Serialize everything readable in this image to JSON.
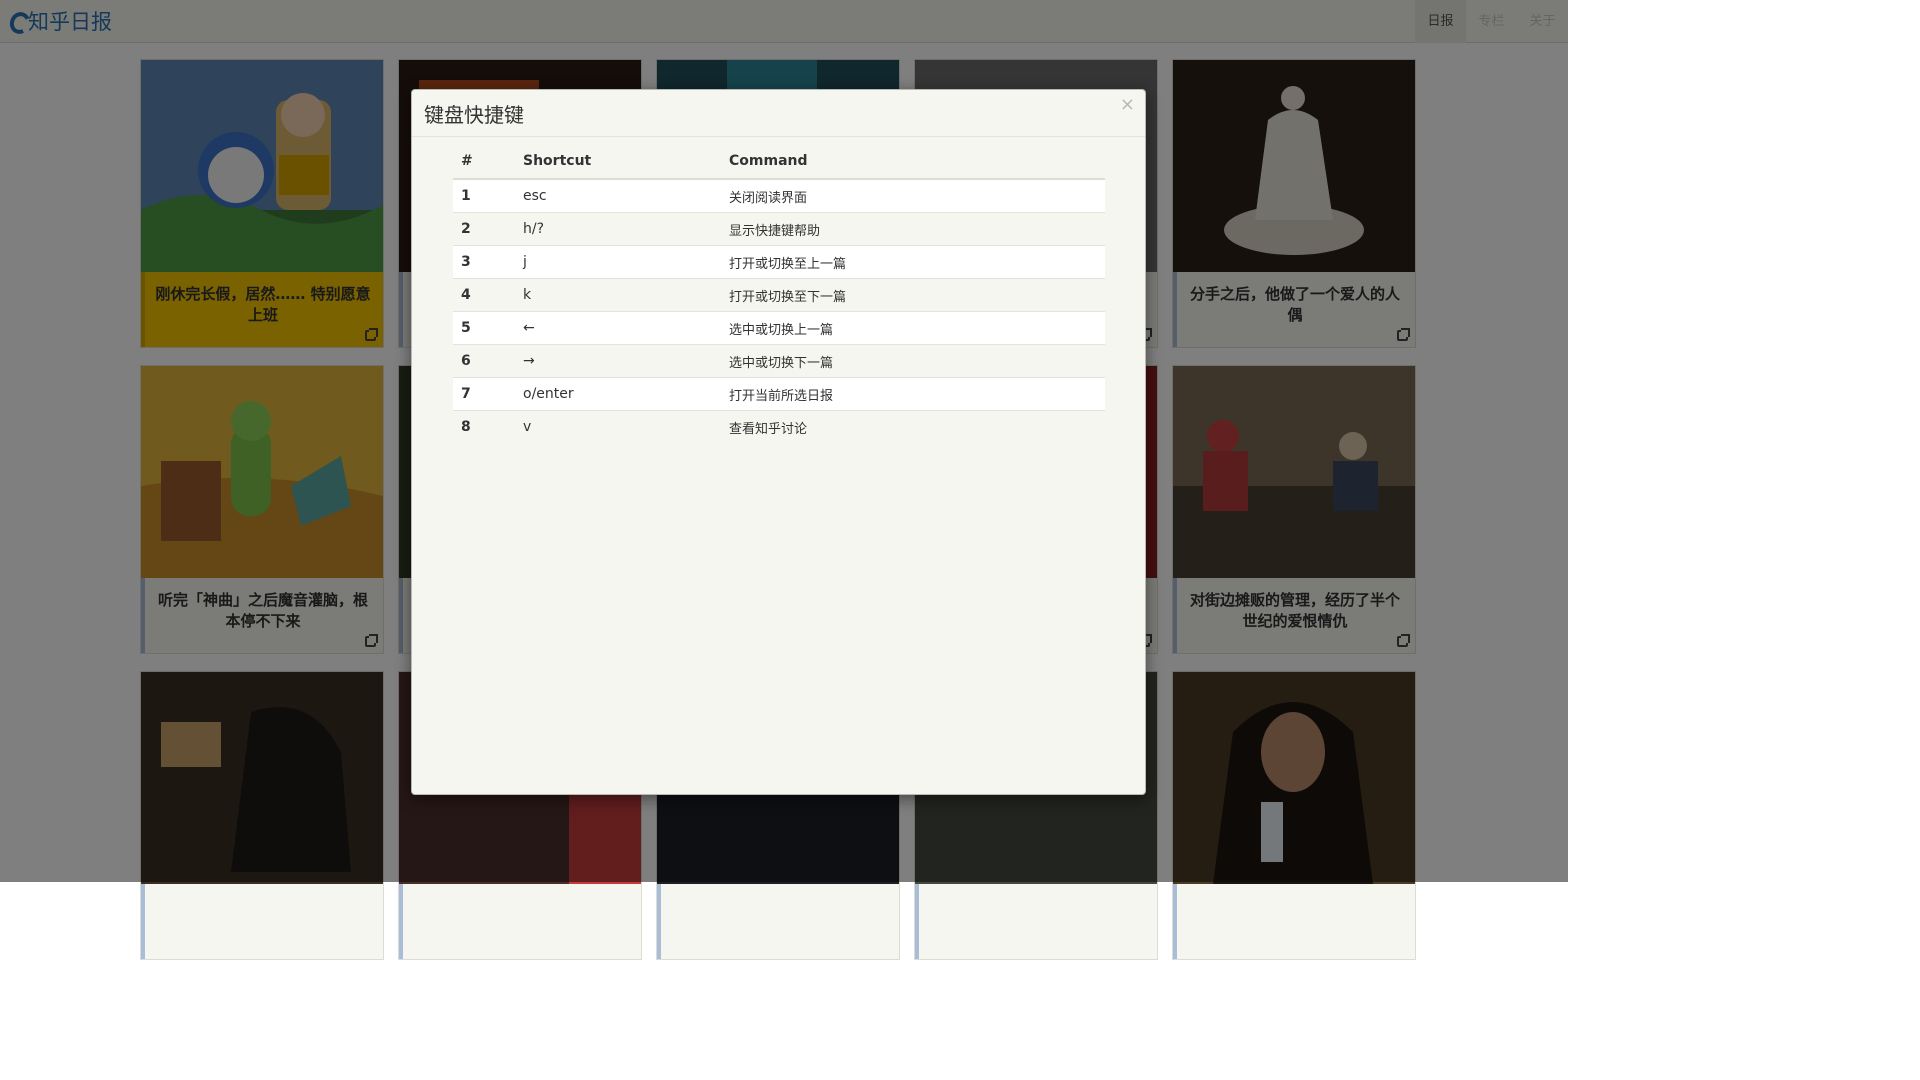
{
  "app": {
    "brand": "知乎日报"
  },
  "nav": {
    "items": [
      "日报",
      "专栏",
      "关于"
    ]
  },
  "cards": [
    {
      "title": "刚休完长假，居然…… 特别愿意上班",
      "img": "doraemon-scene",
      "selected": true
    },
    {
      "title": "",
      "img": "dark-red-scene"
    },
    {
      "title": "",
      "img": "teal-scene"
    },
    {
      "title": "",
      "img": "gray-scene"
    },
    {
      "title": "分手之后，他做了一个爱人的人偶",
      "img": "porcelain-figurine"
    },
    {
      "title": "听完「神曲」之后魔音灌脑，根本停不下来",
      "img": "cartoon-worm-gramophone"
    },
    {
      "title": "",
      "img": "forest-scene"
    },
    {
      "title": "",
      "img": "night-scene"
    },
    {
      "title": "",
      "img": "red-scene"
    },
    {
      "title": "对街边摊贩的管理，经历了半个世纪的爱恨情仇",
      "img": "street-vendors-photo"
    },
    {
      "title": "",
      "img": "go-board-scene"
    },
    {
      "title": "",
      "img": "people-scene"
    },
    {
      "title": "",
      "img": "dark-space-scene"
    },
    {
      "title": "",
      "img": "rain-street-scene"
    },
    {
      "title": "",
      "img": "man-with-bottle"
    }
  ],
  "modal": {
    "title": "键盘快捷键",
    "close_label": "×",
    "table": {
      "headers": [
        "#",
        "Shortcut",
        "Command"
      ],
      "rows": [
        {
          "num": "1",
          "shortcut": "esc",
          "command": "关闭阅读界面"
        },
        {
          "num": "2",
          "shortcut": "h/?",
          "command": "显示快捷键帮助"
        },
        {
          "num": "3",
          "shortcut": "j",
          "command": "打开或切换至上一篇"
        },
        {
          "num": "4",
          "shortcut": "k",
          "command": "打开或切换至下一篇"
        },
        {
          "num": "5",
          "shortcut": "←",
          "command": "选中或切换上一篇"
        },
        {
          "num": "6",
          "shortcut": "→",
          "command": "选中或切换下一篇"
        },
        {
          "num": "7",
          "shortcut": "o/enter",
          "command": "打开当前所选日报"
        },
        {
          "num": "8",
          "shortcut": "v",
          "command": "查看知乎讨论"
        }
      ]
    }
  },
  "colors": {
    "brand": "#2a73b5",
    "selected_caption": "#f5c400",
    "caption_border": "#a9bcd8"
  }
}
